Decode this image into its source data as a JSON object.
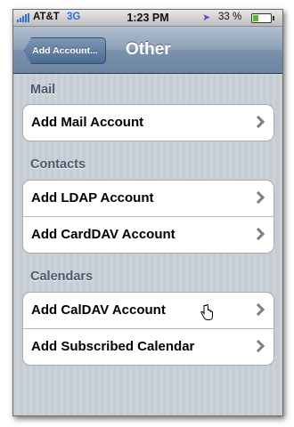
{
  "status_bar": {
    "carrier": "AT&T",
    "network": "3G",
    "time": "1:23 PM",
    "battery_percent": "33 %",
    "battery_level": 0.33,
    "icons": [
      "signal-icon",
      "location-icon",
      "battery-icon"
    ]
  },
  "nav_bar": {
    "back_label": "Add Account...",
    "title": "Other"
  },
  "sections": [
    {
      "header": "Mail",
      "rows": [
        {
          "label": "Add Mail Account"
        }
      ]
    },
    {
      "header": "Contacts",
      "rows": [
        {
          "label": "Add LDAP Account"
        },
        {
          "label": "Add CardDAV Account"
        }
      ]
    },
    {
      "header": "Calendars",
      "rows": [
        {
          "label": "Add CalDAV Account"
        },
        {
          "label": "Add Subscribed Calendar"
        }
      ]
    }
  ],
  "colors": {
    "nav_bar": "#7b91ab",
    "background": "#c5ccd4",
    "section_header": "#4c566c",
    "network": "#2f6fd3"
  }
}
